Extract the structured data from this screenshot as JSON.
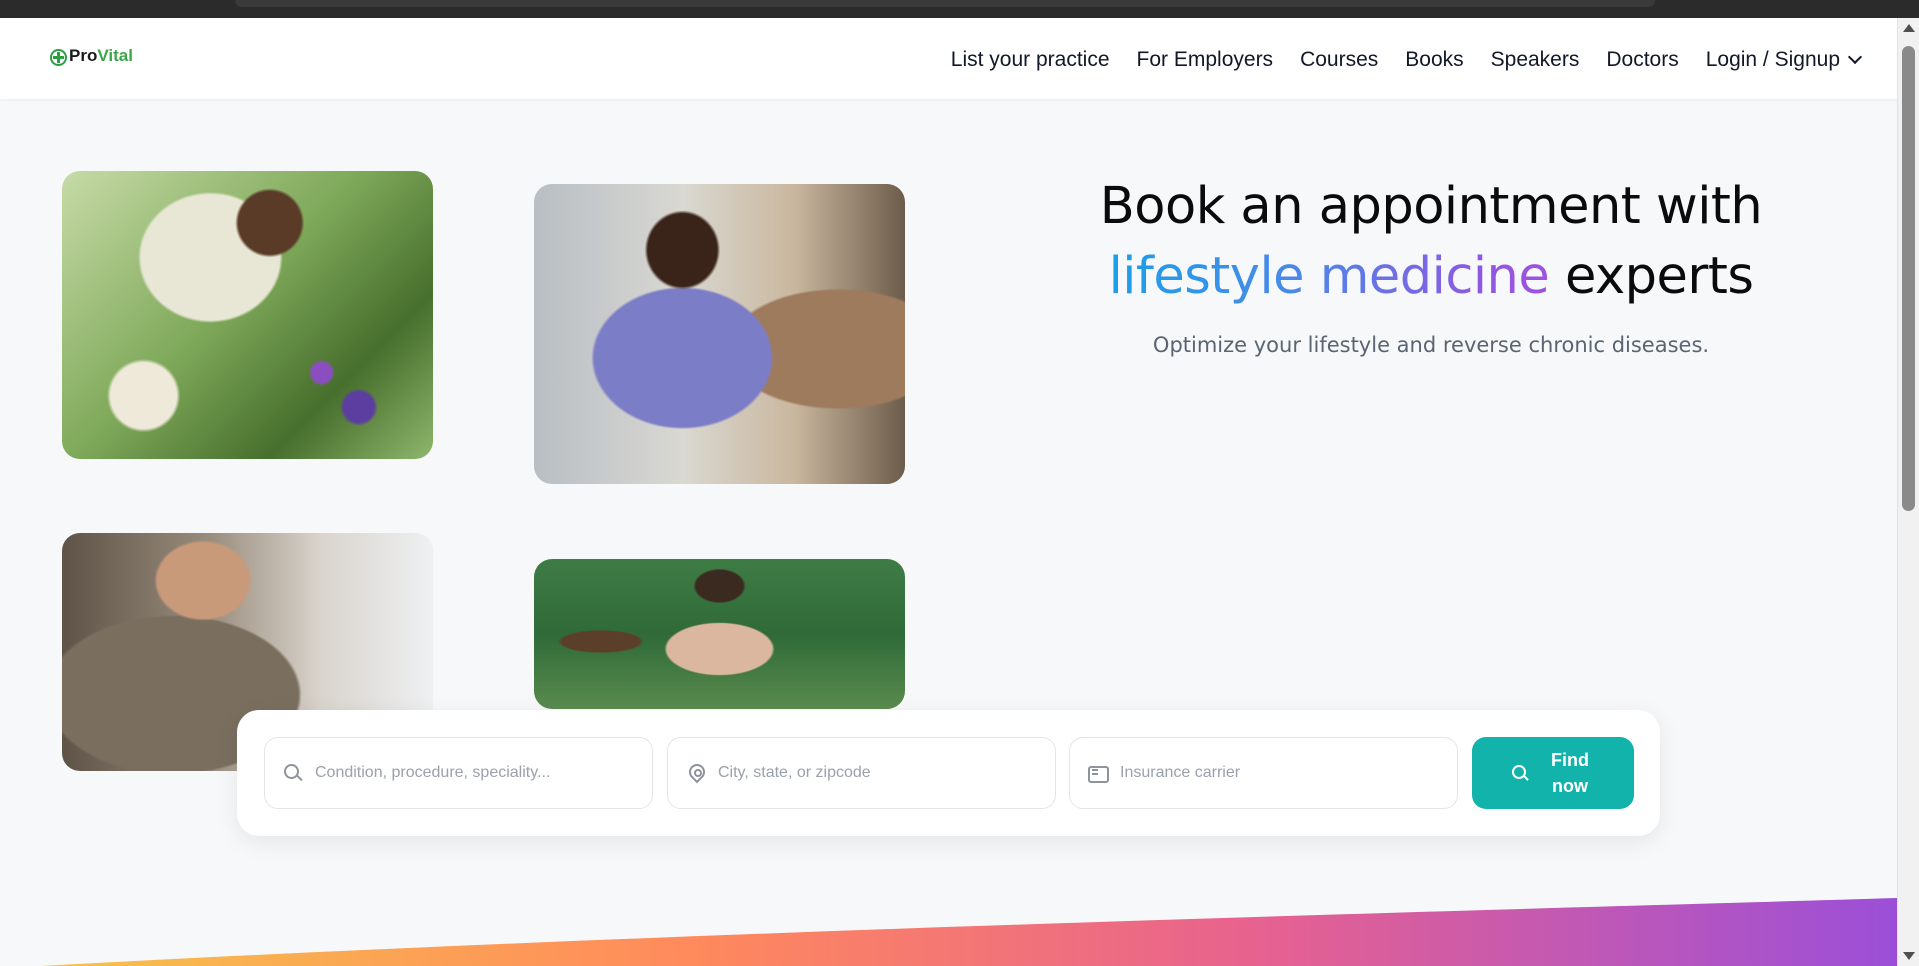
{
  "brand": {
    "name_part1": "Pro",
    "name_part2": "Vital",
    "colors": {
      "primary_green": "#3ba74a",
      "accent_teal": "#12b3ab",
      "gradient_start": "#1aa0e8",
      "gradient_end": "#a052e0"
    }
  },
  "nav": {
    "items": [
      {
        "label": "List your practice"
      },
      {
        "label": "For Employers"
      },
      {
        "label": "Courses"
      },
      {
        "label": "Books"
      },
      {
        "label": "Speakers"
      },
      {
        "label": "Doctors"
      }
    ],
    "login_label": "Login / Signup"
  },
  "hero": {
    "title_line1": "Book an appointment with",
    "title_accent": "lifestyle medicine",
    "title_end": " experts",
    "subtitle": "Optimize your lifestyle and reverse chronic diseases."
  },
  "search": {
    "condition_placeholder": "Condition, procedure, speciality...",
    "location_placeholder": "City, state, or zipcode",
    "insurance_placeholder": "Insurance carrier",
    "button_line1": "Find",
    "button_line2": "now"
  },
  "icons": {
    "logo": "plus-circle-icon",
    "search": "search-icon",
    "location": "map-pin-icon",
    "insurance": "credit-card-icon",
    "dropdown": "chevron-down-icon"
  }
}
